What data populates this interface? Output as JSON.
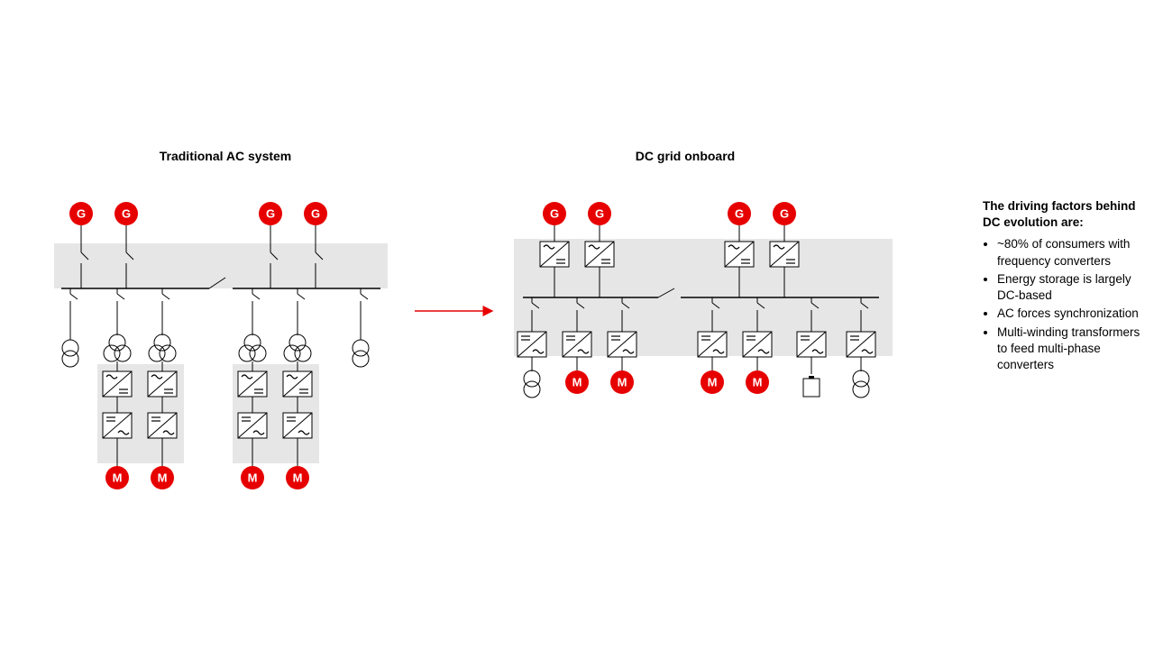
{
  "leftTitle": "Traditional AC system",
  "rightTitle": "DC grid onboard",
  "factorsHeading": "The driving factors behind DC evolution are:",
  "factors": [
    "~80% of consumers with frequency converters",
    "Energy storage is largely DC-based",
    "AC forces synchronization",
    "Multi-winding transformers to feed multi-phase converters"
  ],
  "labels": {
    "G": "G",
    "M": "M"
  },
  "colors": {
    "red": "#e60000",
    "grey": "#e6e6e6",
    "greyMid": "#d9d9d9"
  }
}
